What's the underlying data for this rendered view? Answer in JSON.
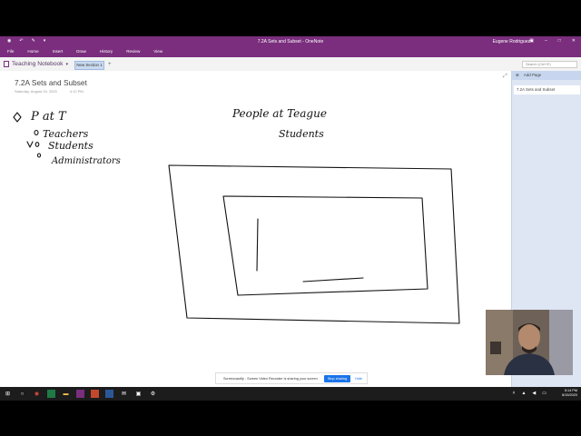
{
  "window": {
    "title": "7.2A Sets and Subset - OneNote",
    "user": "Eugene Rodriguez"
  },
  "ribbon": {
    "tabs": [
      "File",
      "Home",
      "Insert",
      "Draw",
      "History",
      "Review",
      "View"
    ]
  },
  "navbar": {
    "notebook": "Teaching Notebook",
    "section": "New Section 1",
    "add_tab": "+",
    "search_placeholder": "Search (Ctrl+E)"
  },
  "page": {
    "title": "7.2A Sets and Subset",
    "date": "Saturday, August 15, 2020",
    "time": "4:12 PM"
  },
  "handwriting": {
    "heading": "P at T",
    "items": [
      "Teachers",
      "Students",
      "Administrators"
    ],
    "outer_box": "People at Teague",
    "inner_box": "Students"
  },
  "pages_pane": {
    "add_page": "Add Page",
    "pages": [
      "7.2A Sets and Subset"
    ]
  },
  "share_bar": {
    "message": "Screencastify - Screen Video Recorder is sharing your screen.",
    "stop": "Stop sharing",
    "hide": "Hide"
  },
  "taskbar": {
    "time": "5:14 PM",
    "date": "8/15/2020"
  }
}
